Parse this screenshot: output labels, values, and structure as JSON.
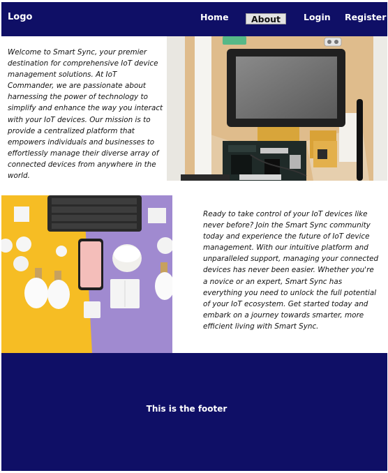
{
  "header": {
    "logo": "Logo",
    "nav": {
      "home": "Home",
      "about": "About",
      "login": "Login",
      "register": "Register"
    },
    "active_item": "About"
  },
  "sections": {
    "intro": {
      "text": "Welcome to Smart Sync, your premier destination for comprehensive IoT device management solutions. At IoT Commander, we are passionate about harnessing the power of technology to simplify and enhance the way you interact with your IoT devices. Our mission is to provide a centralized platform that empowers individuals and businesses to effortlessly manage their diverse array of connected devices from anywhere in the world."
    },
    "cta": {
      "text": "Ready to take control of your IoT devices like never before? Join the Smart Sync community today and experience the future of IoT device management. With our intuitive platform and unparalleled support, managing your connected devices has never been easier. Whether you're a novice or an expert, Smart Sync has everything you need to unlock the full potential of your IoT ecosystem. Get started today and embark on a journey towards smarter, more efficient living with Smart Sync."
    }
  },
  "footer": {
    "text": "This is the footer"
  },
  "colors": {
    "brand_navy": "#0f0f66",
    "active_tab_bg": "#e3e3e3",
    "text": "#111111",
    "footer_text": "#ffffff"
  }
}
